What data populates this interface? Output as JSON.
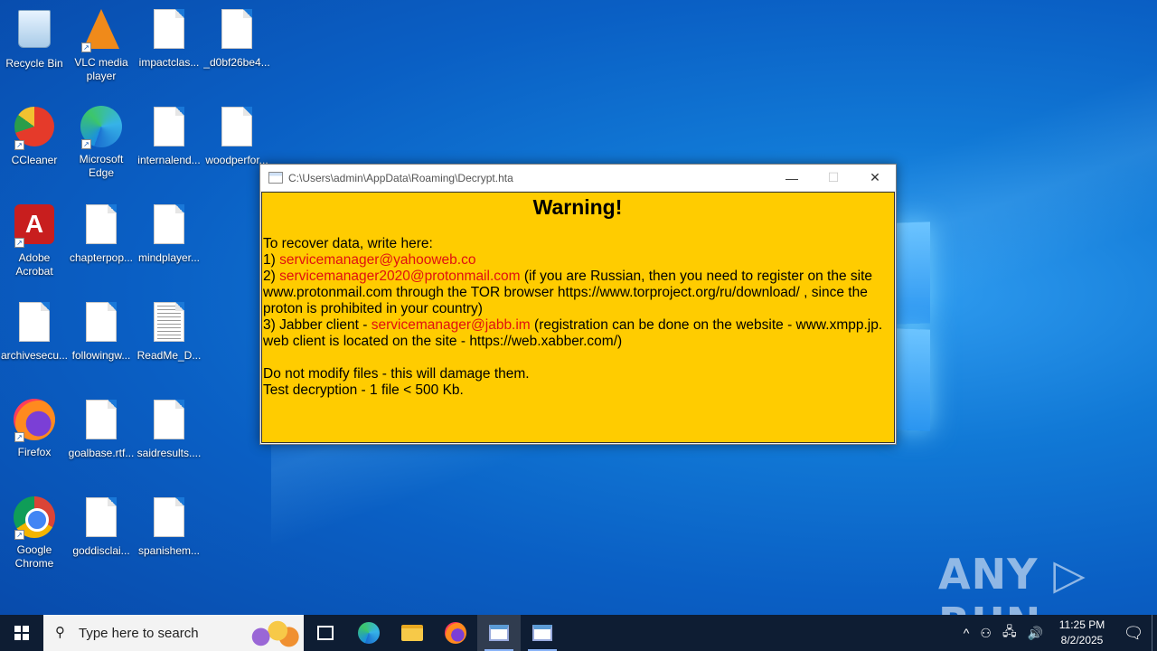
{
  "desktop": {
    "icons": [
      {
        "label": "Recycle Bin"
      },
      {
        "label": "VLC media player"
      },
      {
        "label": "impactclas..."
      },
      {
        "label": "_d0bf26be4..."
      },
      {
        "label": "CCleaner"
      },
      {
        "label": "Microsoft Edge"
      },
      {
        "label": "internalend..."
      },
      {
        "label": "woodperfor..."
      },
      {
        "label": "Adobe Acrobat"
      },
      {
        "label": "chapterpop..."
      },
      {
        "label": "mindplayer..."
      },
      {
        "label": "archivesecu..."
      },
      {
        "label": "followingw..."
      },
      {
        "label": "ReadMe_D..."
      },
      {
        "label": "Firefox"
      },
      {
        "label": "goalbase.rtf..."
      },
      {
        "label": "saidresults...."
      },
      {
        "label": "Google Chrome"
      },
      {
        "label": "goddisclai..."
      },
      {
        "label": "spanishem..."
      }
    ],
    "watermark": "ANY ▷ RUN"
  },
  "window": {
    "title": "C:\\Users\\admin\\AppData\\Roaming\\Decrypt.hta",
    "controls": {
      "minimize": "—",
      "maximize": "☐",
      "close": "✕"
    },
    "heading": "Warning!",
    "intro": "To recover data, write here:",
    "line1_prefix": "1) ",
    "line1_email": "servicemanager@yahooweb.co",
    "line2_prefix": "2) ",
    "line2_email": "servicemanager2020@protonmail.com",
    "line2_rest": " (if you are Russian, then you need to register on the site www.protonmail.com through the TOR browser https://www.torproject.org/ru/download/ , since the proton is prohibited in your country)",
    "line3_prefix": "3) Jabber client - ",
    "line3_email": "servicemanager@jabb.im",
    "line3_rest": " (registration can be done on the website - www.xmpp.jp. web client is located on the site - https://web.xabber.com/)",
    "note1": "Do not modify files - this will damage them.",
    "note2": "Test decryption - 1 file < 500 Kb."
  },
  "taskbar": {
    "search_placeholder": "Type here to search",
    "search_icon": "⚲",
    "tray_icons": [
      "^",
      "⚇",
      "🖧",
      "🔊"
    ],
    "time": "11:25 PM",
    "date": "8/2/2025",
    "notification_icon": "🗨"
  },
  "colors": {
    "window_bg": "#ffcc00",
    "email_red": "#e01010",
    "taskbar": "#0e1d33"
  }
}
